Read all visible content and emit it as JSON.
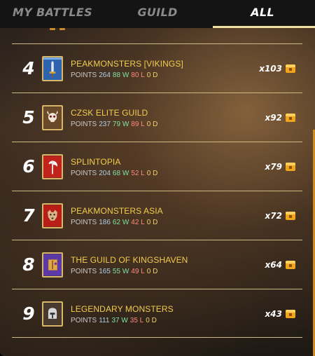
{
  "tabs": [
    {
      "label": "MY BATTLES",
      "active": false
    },
    {
      "label": "GUILD",
      "active": false
    },
    {
      "label": "ALL",
      "active": true
    }
  ],
  "colors": {
    "accent_gold": "#f2cd4f",
    "divider": "#cdbb86",
    "wins": "#7fe3a4",
    "losses": "#ff8a7e",
    "draws": "#f3d06a",
    "points": "#aad0e8"
  },
  "rows": [
    {
      "rank": "4",
      "name": "PEAKMONSTERS [VIKINGS]",
      "points_label": "POINTS",
      "points": "264",
      "wins": "88 W",
      "losses": "80 L",
      "draws": "0 D",
      "reward": "x103",
      "icon": "sword-banner-icon"
    },
    {
      "rank": "5",
      "name": "CZSK ELITE GUILD",
      "points_label": "POINTS",
      "points": "237",
      "wins": "79 W",
      "losses": "89 L",
      "draws": "0 D",
      "reward": "x92",
      "icon": "skull-banner-icon"
    },
    {
      "rank": "6",
      "name": "SPLINTOPIA",
      "points_label": "POINTS",
      "points": "204",
      "wins": "68 W",
      "losses": "52 L",
      "draws": "0 D",
      "reward": "x79",
      "icon": "axe-banner-icon"
    },
    {
      "rank": "7",
      "name": "PEAKMONSTERS ASIA",
      "points_label": "POINTS",
      "points": "186",
      "wins": "62 W",
      "losses": "42 L",
      "draws": "0 D",
      "reward": "x72",
      "icon": "wolf-banner-icon"
    },
    {
      "rank": "8",
      "name": "THE GUILD OF KINGSHAVEN",
      "points_label": "POINTS",
      "points": "165",
      "wins": "55 W",
      "losses": "49 L",
      "draws": "0 D",
      "reward": "x64",
      "icon": "book-banner-icon"
    },
    {
      "rank": "9",
      "name": "LEGENDARY MONSTERS",
      "points_label": "POINTS",
      "points": "111",
      "wins": "37 W",
      "losses": "35 L",
      "draws": "0 D",
      "reward": "x43",
      "icon": "helmet-banner-icon"
    }
  ]
}
